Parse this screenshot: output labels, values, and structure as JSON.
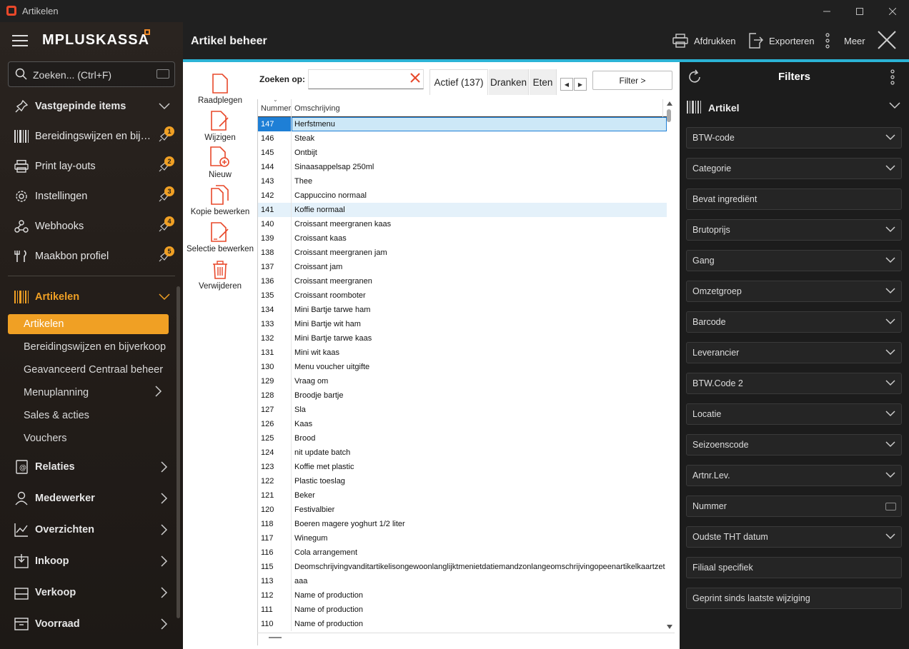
{
  "window": {
    "title": "Artikelen"
  },
  "sidebar": {
    "logo_main": "MPLUS",
    "logo_second": "KASSA",
    "search_placeholder": "Zoeken... (Ctrl+F)",
    "pinned_header": "Vastgepinde items",
    "pinned": [
      {
        "label": "Bereidingswijzen en bijverkoop",
        "badge": "1"
      },
      {
        "label": "Print lay-outs",
        "badge": "2"
      },
      {
        "label": "Instellingen",
        "badge": "3"
      },
      {
        "label": "Webhooks",
        "badge": "4"
      },
      {
        "label": "Maakbon profiel",
        "badge": "5"
      }
    ],
    "section_active": "Artikelen",
    "sub_items": [
      {
        "label": "Artikelen"
      },
      {
        "label": "Bereidingswijzen en bijverkoop"
      },
      {
        "label": "Geavanceerd Centraal beheer"
      },
      {
        "label": "Menuplanning"
      },
      {
        "label": "Sales & acties"
      },
      {
        "label": "Vouchers"
      }
    ],
    "sections": [
      {
        "label": "Relaties"
      },
      {
        "label": "Medewerker"
      },
      {
        "label": "Overzichten"
      },
      {
        "label": "Inkoop"
      },
      {
        "label": "Verkoop"
      },
      {
        "label": "Voorraad"
      }
    ]
  },
  "header": {
    "title": "Artikel beheer",
    "print": "Afdrukken",
    "export": "Exporteren",
    "more": "Meer"
  },
  "actions": {
    "raadplegen": "Raadplegen",
    "wijzigen": "Wijzigen",
    "nieuw": "Nieuw",
    "kopie": "Kopie bewerken",
    "selectie": "Selectie bewerken",
    "verwijderen": "Verwijderen"
  },
  "search": {
    "label": "Zoeken op:",
    "value": ""
  },
  "tabs": {
    "actief": "Actief (137)",
    "dranken": "Dranken",
    "eten": "Eten",
    "filter_button": "Filter >"
  },
  "grid": {
    "col_number": "Nummer",
    "col_desc": "Omschrijving",
    "rows": [
      {
        "n": "147",
        "d": "Herfstmenu"
      },
      {
        "n": "146",
        "d": "Steak"
      },
      {
        "n": "145",
        "d": "Ontbijt"
      },
      {
        "n": "144",
        "d": "Sinaasappelsap 250ml"
      },
      {
        "n": "143",
        "d": "Thee"
      },
      {
        "n": "142",
        "d": "Cappuccino normaal"
      },
      {
        "n": "141",
        "d": "Koffie normaal"
      },
      {
        "n": "140",
        "d": "Croissant meergranen kaas"
      },
      {
        "n": "139",
        "d": "Croissant kaas"
      },
      {
        "n": "138",
        "d": "Croissant meergranen jam"
      },
      {
        "n": "137",
        "d": "Croissant jam"
      },
      {
        "n": "136",
        "d": "Croissant meergranen"
      },
      {
        "n": "135",
        "d": "Croissant roomboter"
      },
      {
        "n": "134",
        "d": "Mini Bartje tarwe ham"
      },
      {
        "n": "133",
        "d": "Mini Bartje wit ham"
      },
      {
        "n": "132",
        "d": "Mini Bartje tarwe kaas"
      },
      {
        "n": "131",
        "d": "Mini wit kaas"
      },
      {
        "n": "130",
        "d": "Menu voucher uitgifte"
      },
      {
        "n": "129",
        "d": "Vraag om"
      },
      {
        "n": "128",
        "d": "Broodje bartje"
      },
      {
        "n": "127",
        "d": "Sla"
      },
      {
        "n": "126",
        "d": "Kaas"
      },
      {
        "n": "125",
        "d": "Brood"
      },
      {
        "n": "124",
        "d": "nit update batch"
      },
      {
        "n": "123",
        "d": "Koffie met plastic"
      },
      {
        "n": "122",
        "d": "Plastic toeslag"
      },
      {
        "n": "121",
        "d": "Beker"
      },
      {
        "n": "120",
        "d": "Festivalbier"
      },
      {
        "n": "118",
        "d": "Boeren magere yoghurt 1/2 liter"
      },
      {
        "n": "117",
        "d": "Winegum"
      },
      {
        "n": "116",
        "d": "Cola arrangement"
      },
      {
        "n": "115",
        "d": "Deomschrijvingvanditartikelisongewoonlanglijktmenietdatiemandzonlangeomschrijvingopeenartikelkaartzet"
      },
      {
        "n": "113",
        "d": "aaa"
      },
      {
        "n": "112",
        "d": "Name of production"
      },
      {
        "n": "111",
        "d": "Name of production"
      },
      {
        "n": "110",
        "d": "Name of production"
      }
    ]
  },
  "filters": {
    "title": "Filters",
    "section": "Artikel",
    "fields": [
      {
        "label": "BTW-code",
        "kind": "dropdown"
      },
      {
        "label": "Categorie",
        "kind": "dropdown"
      },
      {
        "label": "Bevat ingrediënt",
        "kind": "text"
      },
      {
        "label": "Brutoprijs",
        "kind": "dropdown"
      },
      {
        "label": "Gang",
        "kind": "dropdown"
      },
      {
        "label": "Omzetgroep",
        "kind": "dropdown"
      },
      {
        "label": "Barcode",
        "kind": "dropdown"
      },
      {
        "label": "Leverancier",
        "kind": "dropdown"
      },
      {
        "label": "BTW.Code 2",
        "kind": "dropdown"
      },
      {
        "label": "Locatie",
        "kind": "dropdown"
      },
      {
        "label": "Seizoenscode",
        "kind": "dropdown"
      },
      {
        "label": "Artnr.Lev.",
        "kind": "dropdown"
      },
      {
        "label": "Nummer",
        "kind": "keyboard"
      },
      {
        "label": "Oudste THT datum",
        "kind": "dropdown"
      },
      {
        "label": "Filiaal specifiek",
        "kind": "text"
      },
      {
        "label": "Geprint sinds laatste wijziging",
        "kind": "text"
      }
    ]
  },
  "colors": {
    "accent": "#f0a024",
    "header_bar": "#2bb3d6",
    "selection": "#1e7fd6",
    "brand": "#e8482a"
  }
}
